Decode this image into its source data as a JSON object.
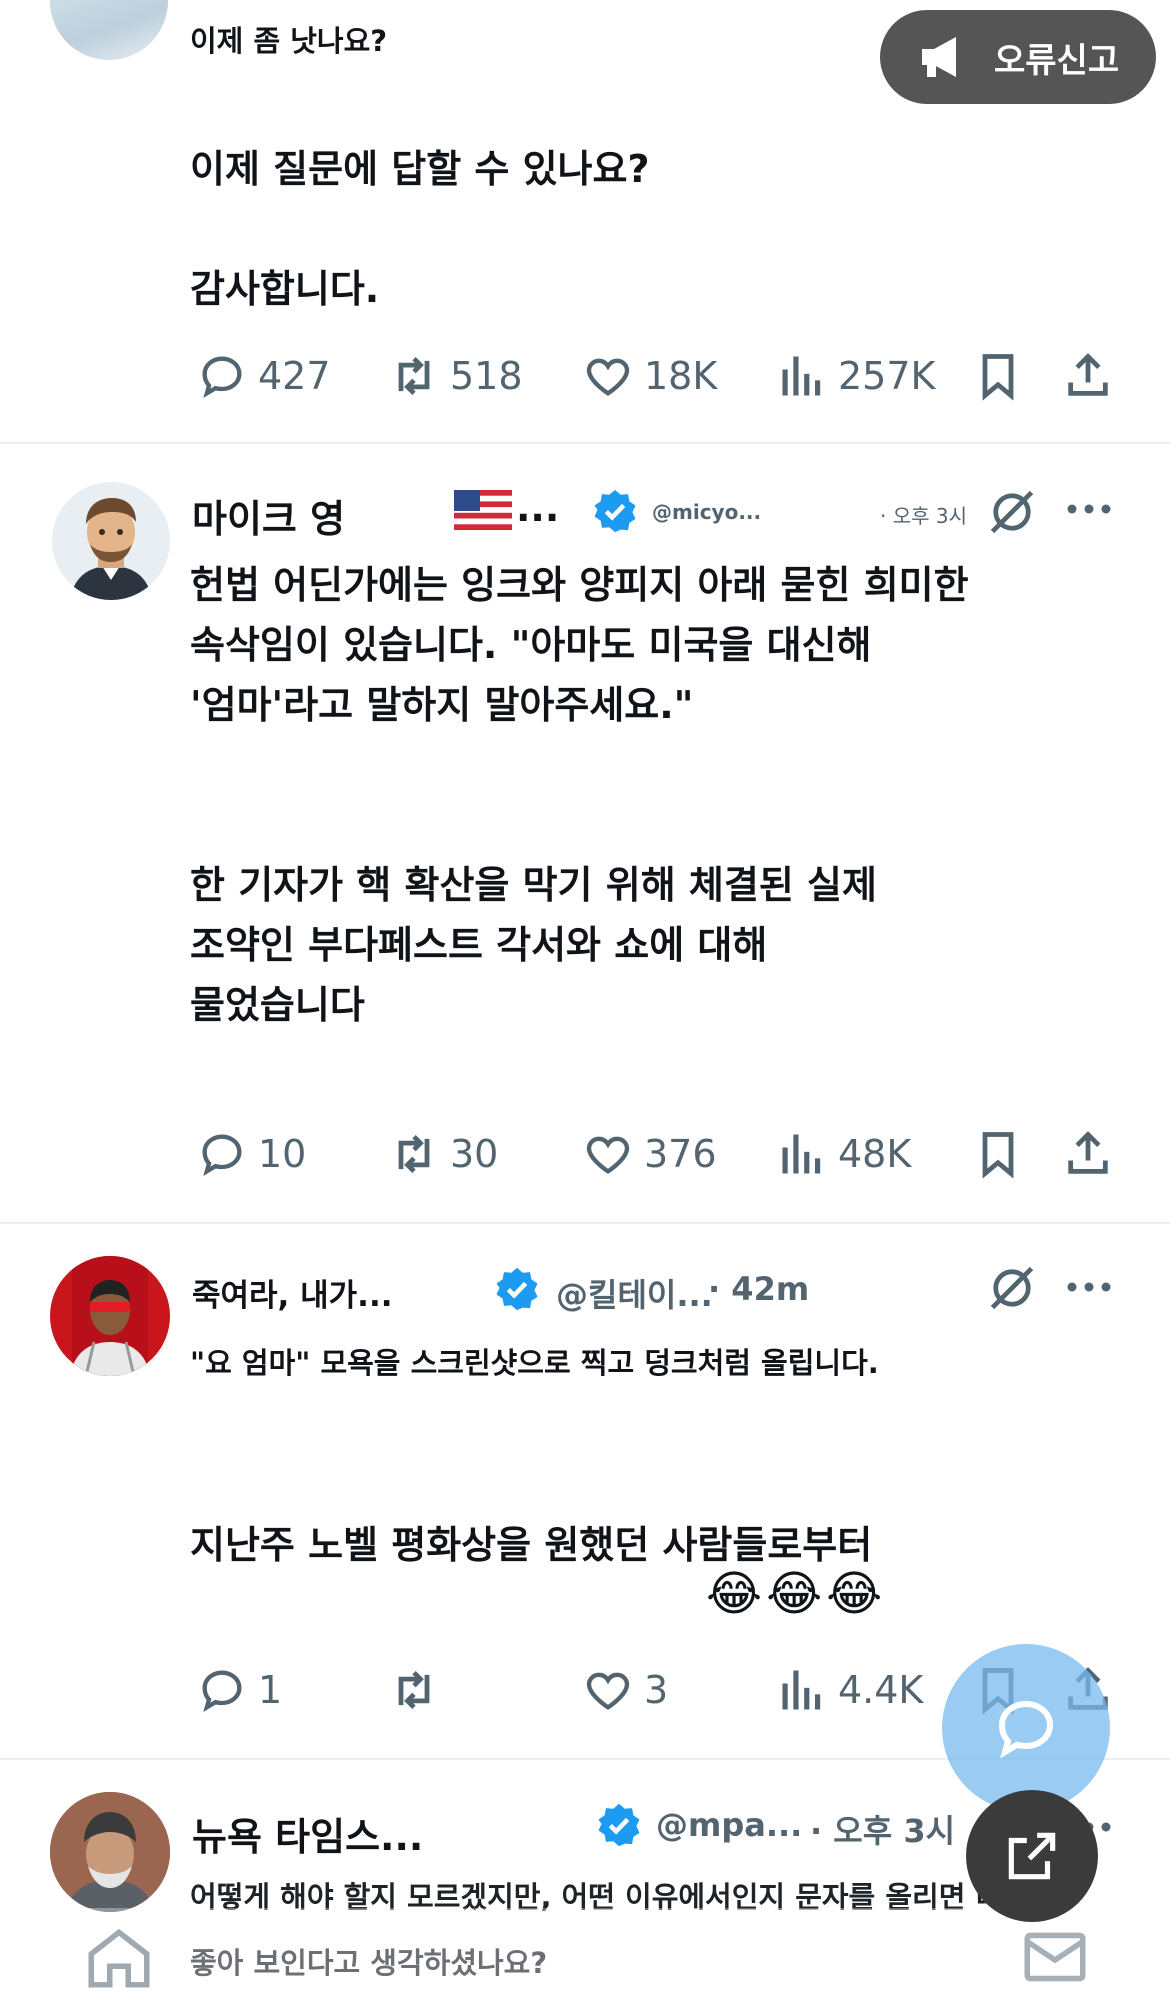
{
  "report_button": {
    "label": "오류신고",
    "icon": "megaphone-icon"
  },
  "post1": {
    "lines": [
      "이제 좀 낫나요?",
      "이제 질문에 답할 수 있나요?",
      "감사합니다."
    ],
    "actions": {
      "replies": "427",
      "reposts": "518",
      "likes": "18K",
      "views": "257K"
    }
  },
  "post2": {
    "name": "마이크 영",
    "flag": "🇺🇸",
    "flag_suffix": "...",
    "handle": "@micyo...",
    "time": "· 오후 3시",
    "lines": [
      "헌법 어딘가에는 잉크와 양피지 아래 묻힌 희미한",
      "속삭임이 있습니다. \"아마도 미국을 대신해",
      "'엄마'라고 말하지 말아주세요.\"",
      "한 기자가 핵 확산을 막기 위해 체결된 실제",
      "조약인 부다페스트 각서와 쇼에 대해",
      "물었습니다"
    ],
    "actions": {
      "replies": "10",
      "reposts": "30",
      "likes": "376",
      "views": "48K"
    }
  },
  "post3": {
    "name": "죽여라, 내가...",
    "handle": "@킬테이...",
    "time": "· 42m",
    "lines": [
      "\"요 엄마\" 모욕을 스크린샷으로 찍고 덩크처럼 올립니다.",
      "지난주 노벨 평화상을 원했던 사람들로부터"
    ],
    "emoji": "😂😂😂",
    "actions": {
      "replies": "1",
      "reposts": "",
      "likes": "3",
      "views": "4.4K"
    }
  },
  "post4": {
    "name": "뉴욕 타임스...",
    "handle": "@mpa...",
    "time": "· 오후 3시",
    "lines": [
      "어떻게 해야 할지 모르겠지만, 어떤 이유에서인지 문자를 올리면 너",
      "좋아 보인다고 생각하셨나요?"
    ]
  },
  "colors": {
    "text": "#101418",
    "muted": "#536471",
    "verified": "#1d9bf0",
    "report_bg": "#555555"
  }
}
